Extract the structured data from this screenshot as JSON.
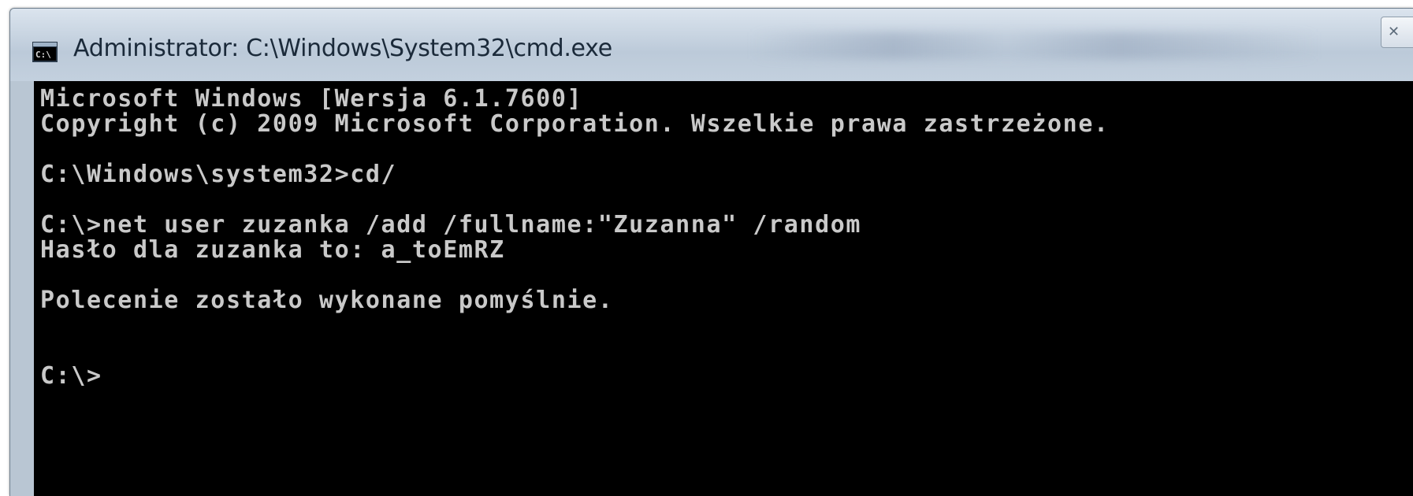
{
  "window": {
    "title": "Administrator: C:\\Windows\\System32\\cmd.exe",
    "icon": "cmd-icon",
    "close_icon": "close-icon"
  },
  "console": {
    "lines": [
      "Microsoft Windows [Wersja 6.1.7600]",
      "Copyright (c) 2009 Microsoft Corporation. Wszelkie prawa zastrzeżone.",
      "C:\\Windows\\system32>cd/",
      "C:\\>net user zuzanka /add /fullname:\"Zuzanna\" /random",
      "Hasło dla zuzanka to: a_toEmRZ",
      "Polecenie zostało wykonane pomyślnie.",
      "C:\\>"
    ]
  },
  "colors": {
    "console_bg": "#000000",
    "console_text": "#c9c9c9",
    "titlebar": "#c9d5e2"
  }
}
